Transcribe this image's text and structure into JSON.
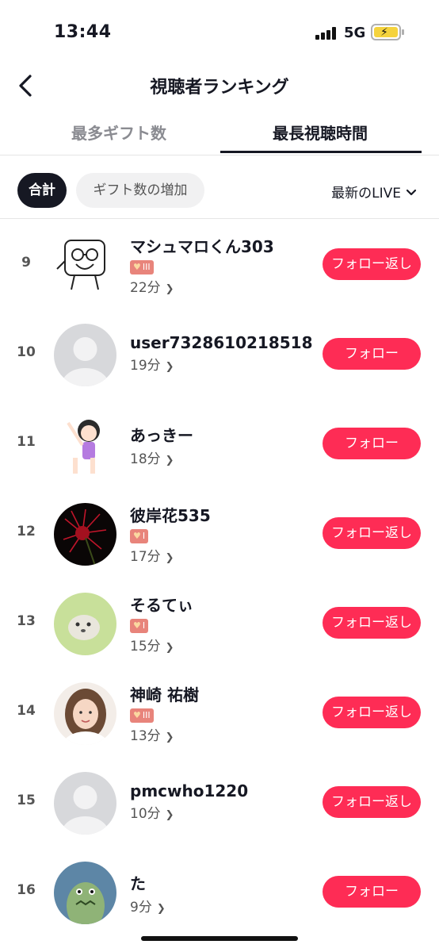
{
  "status_bar": {
    "time": "13:44",
    "network": "5G"
  },
  "header": {
    "title": "視聴者ランキング"
  },
  "tabs": [
    {
      "label": "最多ギフト数",
      "active": false
    },
    {
      "label": "最長視聴時間",
      "active": true
    }
  ],
  "filters": {
    "total": "合計",
    "gift_increase": "ギフト数の増加",
    "sort": "最新のLIVE"
  },
  "users": [
    {
      "rank": "9",
      "name": "マシュマロくん303",
      "badge": "III",
      "duration": "22分",
      "button": "フォロー返し"
    },
    {
      "rank": "10",
      "name": "user7328610218518",
      "badge": "",
      "duration": "19分",
      "button": "フォロー"
    },
    {
      "rank": "11",
      "name": "あっきー",
      "badge": "",
      "duration": "18分",
      "button": "フォロー"
    },
    {
      "rank": "12",
      "name": "彼岸花535",
      "badge": "I",
      "duration": "17分",
      "button": "フォロー返し"
    },
    {
      "rank": "13",
      "name": "そるてぃ",
      "badge": "I",
      "duration": "15分",
      "button": "フォロー返し"
    },
    {
      "rank": "14",
      "name": "神崎 祐樹",
      "badge": "III",
      "duration": "13分",
      "button": "フォロー返し"
    },
    {
      "rank": "15",
      "name": "pmcwho1220",
      "badge": "",
      "duration": "10分",
      "button": "フォロー返し"
    },
    {
      "rank": "16",
      "name": "た",
      "badge": "",
      "duration": "9分",
      "button": "フォロー"
    }
  ],
  "colors": {
    "accent": "#fe2c55",
    "badge": "#e8847b",
    "text": "#161823",
    "muted": "#8a8b91"
  },
  "icons": [
    "back-chevron-icon",
    "signal-icon",
    "battery-icon",
    "chevron-down-icon",
    "chevron-right-icon",
    "heart-badge-icon"
  ]
}
